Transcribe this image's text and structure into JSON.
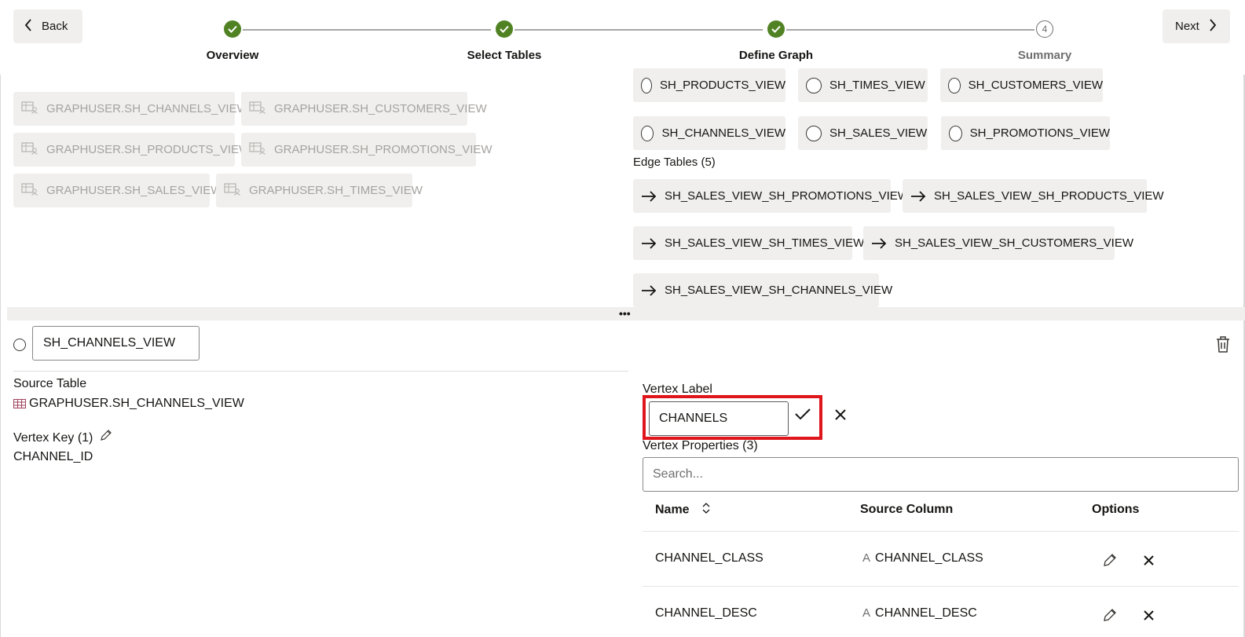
{
  "nav": {
    "back_label": "Back",
    "next_label": "Next"
  },
  "steps": [
    {
      "label": "Overview",
      "status": "done"
    },
    {
      "label": "Select Tables",
      "status": "done"
    },
    {
      "label": "Define Graph",
      "status": "done"
    },
    {
      "label": "Summary",
      "status": "pending",
      "number": "4"
    }
  ],
  "source_tables": [
    "GRAPHUSER.SH_CHANNELS_VIEW",
    "GRAPHUSER.SH_CUSTOMERS_VIEW",
    "GRAPHUSER.SH_PRODUCTS_VIEW",
    "GRAPHUSER.SH_PROMOTIONS_VIEW",
    "GRAPHUSER.SH_SALES_VIEW",
    "GRAPHUSER.SH_TIMES_VIEW"
  ],
  "vertex_tables": [
    "SH_PRODUCTS_VIEW",
    "SH_TIMES_VIEW",
    "SH_CUSTOMERS_VIEW",
    "SH_CHANNELS_VIEW",
    "SH_SALES_VIEW",
    "SH_PROMOTIONS_VIEW"
  ],
  "edge_tables_title": "Edge Tables (5)",
  "edge_tables": [
    "SH_SALES_VIEW_SH_PROMOTIONS_VIEW",
    "SH_SALES_VIEW_SH_PRODUCTS_VIEW",
    "SH_SALES_VIEW_SH_TIMES_VIEW",
    "SH_SALES_VIEW_SH_CUSTOMERS_VIEW",
    "SH_SALES_VIEW_SH_CHANNELS_VIEW"
  ],
  "detail": {
    "name_value": "SH_CHANNELS_VIEW",
    "source_table_label": "Source Table",
    "source_table_value": "GRAPHUSER.SH_CHANNELS_VIEW",
    "vertex_key_label": "Vertex Key (1)",
    "vertex_key_value": "CHANNEL_ID",
    "vertex_label_title": "Vertex Label",
    "vertex_label_value": "CHANNELS",
    "vertex_properties_title": "Vertex Properties (3)",
    "search_placeholder": "Search...",
    "columns": {
      "name": "Name",
      "source_column": "Source Column",
      "options": "Options"
    },
    "rows": [
      {
        "name": "CHANNEL_CLASS",
        "source_column": "CHANNEL_CLASS",
        "type_glyph": "A"
      },
      {
        "name": "CHANNEL_DESC",
        "source_column": "CHANNEL_DESC",
        "type_glyph": "A"
      }
    ]
  },
  "colors": {
    "step_done": "#508223",
    "highlight": "#e0161d",
    "chip_bg": "#f1efed"
  }
}
